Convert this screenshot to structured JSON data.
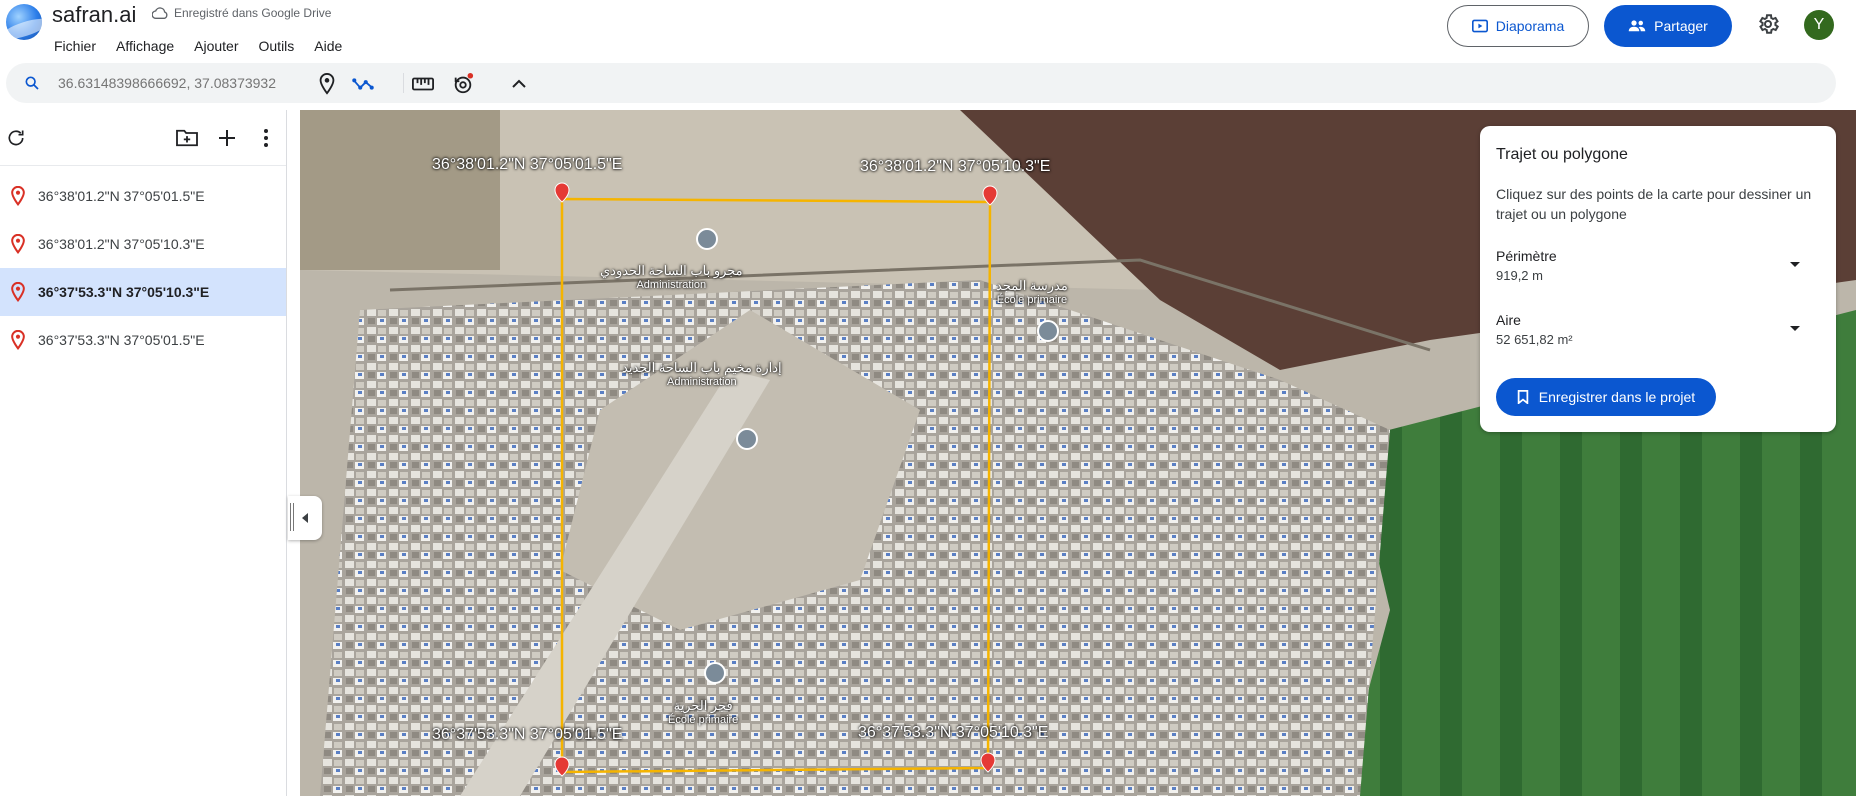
{
  "app": {
    "title": "safran.ai",
    "saved_status": "Enregistré dans Google Drive"
  },
  "menu": [
    "Fichier",
    "Affichage",
    "Ajouter",
    "Outils",
    "Aide"
  ],
  "header_buttons": {
    "slideshow": "Diaporama",
    "share": "Partager",
    "avatar_initial": "Y"
  },
  "search": {
    "placeholder": "36.63148398666692, 37.08373932"
  },
  "sidebar": {
    "items": [
      {
        "label": "36°38'01.2\"N 37°05'01.5\"E",
        "active": false
      },
      {
        "label": "36°38'01.2\"N 37°05'10.3\"E",
        "active": false
      },
      {
        "label": "36°37'53.3\"N 37°05'10.3\"E",
        "active": true
      },
      {
        "label": "36°37'53.3\"N 37°05'01.5\"E",
        "active": false
      }
    ]
  },
  "panel": {
    "title": "Trajet ou polygone",
    "description": "Cliquez sur des points de la carte pour dessiner un trajet ou un polygone",
    "perimeter_label": "Périmètre",
    "perimeter_value": "919,2 m",
    "area_label": "Aire",
    "area_value": "52 651,82 m²",
    "save_button": "Enregistrer dans le projet"
  },
  "map": {
    "corner_labels": {
      "nw": "36°38'01.2\"N 37°05'01.5\"E",
      "ne": "36°38'01.2\"N 37°05'10.3\"E",
      "sw": "36°37'53.3\"N 37°05'01.5\"E",
      "se": "36°37'53.3\"N 37°05'10.3\"E"
    },
    "pois": [
      {
        "ar": "مجرو باب الساحة الحدودي",
        "fr": "Administration"
      },
      {
        "ar": "إدارة مخيم باب الساحة الجديد",
        "fr": "Administration"
      },
      {
        "ar": "مدرسة المجد",
        "fr": "École primaire"
      },
      {
        "ar": "فجر الحرية",
        "fr": "École primaire"
      }
    ],
    "polygon_color": "#f5b400"
  },
  "colors": {
    "accent": "#0b57d0",
    "active_item_bg": "#d3e3fd",
    "avatar_bg": "#33691e"
  }
}
